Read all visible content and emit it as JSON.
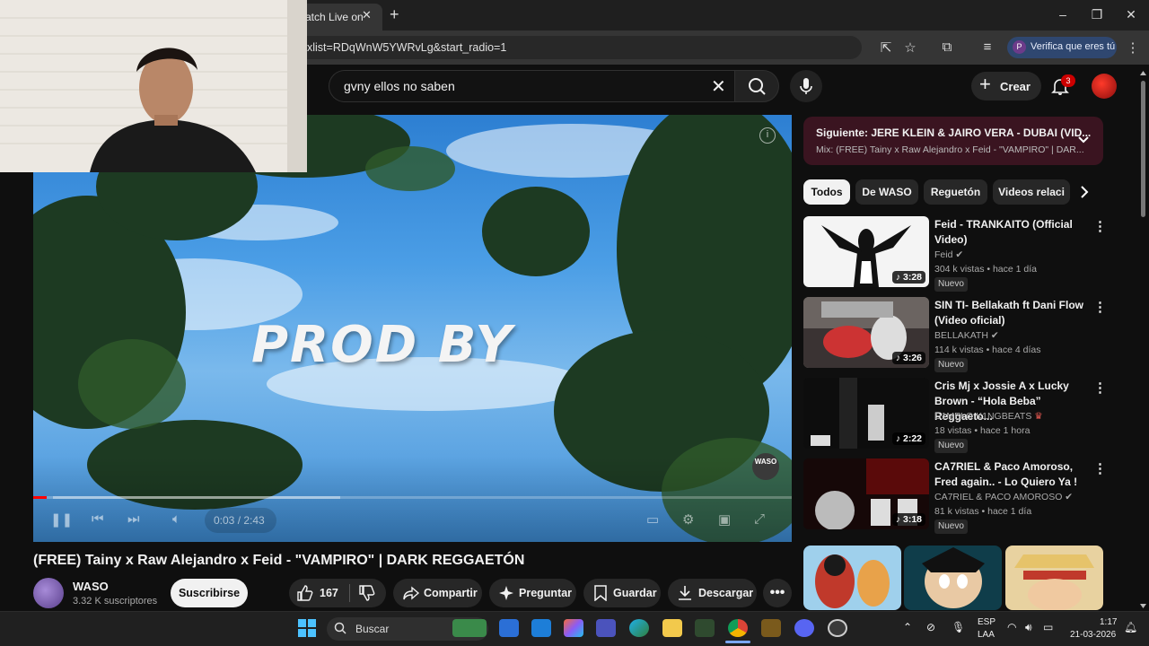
{
  "browser": {
    "tab_title": "atch Live on",
    "url": "xlist=RDqWnW5YWRvLg&start_radio=1",
    "verify_label": "Verifica que eres tú",
    "verify_avatar_letter": "P"
  },
  "header": {
    "search_value": "gvny ellos no saben",
    "create_label": "Crear",
    "notifications_count": "3"
  },
  "video": {
    "overlay_text": "PROD BY",
    "time": "0:03 / 2:43",
    "watermark": "WASO",
    "progress_fraction": 0.018,
    "title": "(FREE) Tainy x Raw Alejandro x Feid - \"VAMPIRO\" | DARK REGGAETÓN"
  },
  "channel": {
    "name": "WASO",
    "subscribers": "3.32 K suscriptores",
    "subscribe_label": "Suscribirse"
  },
  "actions": {
    "likes": "167",
    "share": "Compartir",
    "ask": "Preguntar",
    "save": "Guardar",
    "download": "Descargar"
  },
  "playlist": {
    "next": "Siguiente: JERE KLEIN & JAIRO VERA - DUBAI (VID...",
    "mix": "Mix: (FREE) Tainy x Raw Alejandro x Feid - \"VAMPIRO\" | DAR..."
  },
  "chips": [
    "Todos",
    "De WASO",
    "Reguetón",
    "Videos relaci"
  ],
  "recommendations": [
    {
      "title": "Feid - TRANKAITO (Official Video)",
      "channel": "Feid",
      "verified": true,
      "meta": "304 k vistas • hace 1 día",
      "badge": "Nuevo",
      "duration": "3:28"
    },
    {
      "title": "SIN TI- Bellakath ft Dani Flow (Video oficial)",
      "channel": "BELLAKATH",
      "verified": true,
      "meta": "114 k vistas • hace 4 días",
      "badge": "Nuevo",
      "duration": "3:26"
    },
    {
      "title": "Cris Mj x Jossie A x Lucky Brown - “Hola Beba” Reggaeto...",
      "channel": "D1MELO K1NGBEATS",
      "verified": false,
      "meta": "18 vistas • hace 1 hora",
      "badge": "Nuevo",
      "duration": "2:22"
    },
    {
      "title": "CA7RIEL & Paco Amoroso, Fred again.. - Lo Quiero Ya !",
      "channel": "CA7RIEL & PACO AMOROSO",
      "verified": true,
      "meta": "81 k vistas • hace 1 día",
      "badge": "Nuevo",
      "duration": "3:18"
    }
  ],
  "taskbar": {
    "search_placeholder": "Buscar",
    "language_top": "ESP",
    "language_bottom": "LAA",
    "time": "1:17",
    "date": "21-03-2026"
  }
}
